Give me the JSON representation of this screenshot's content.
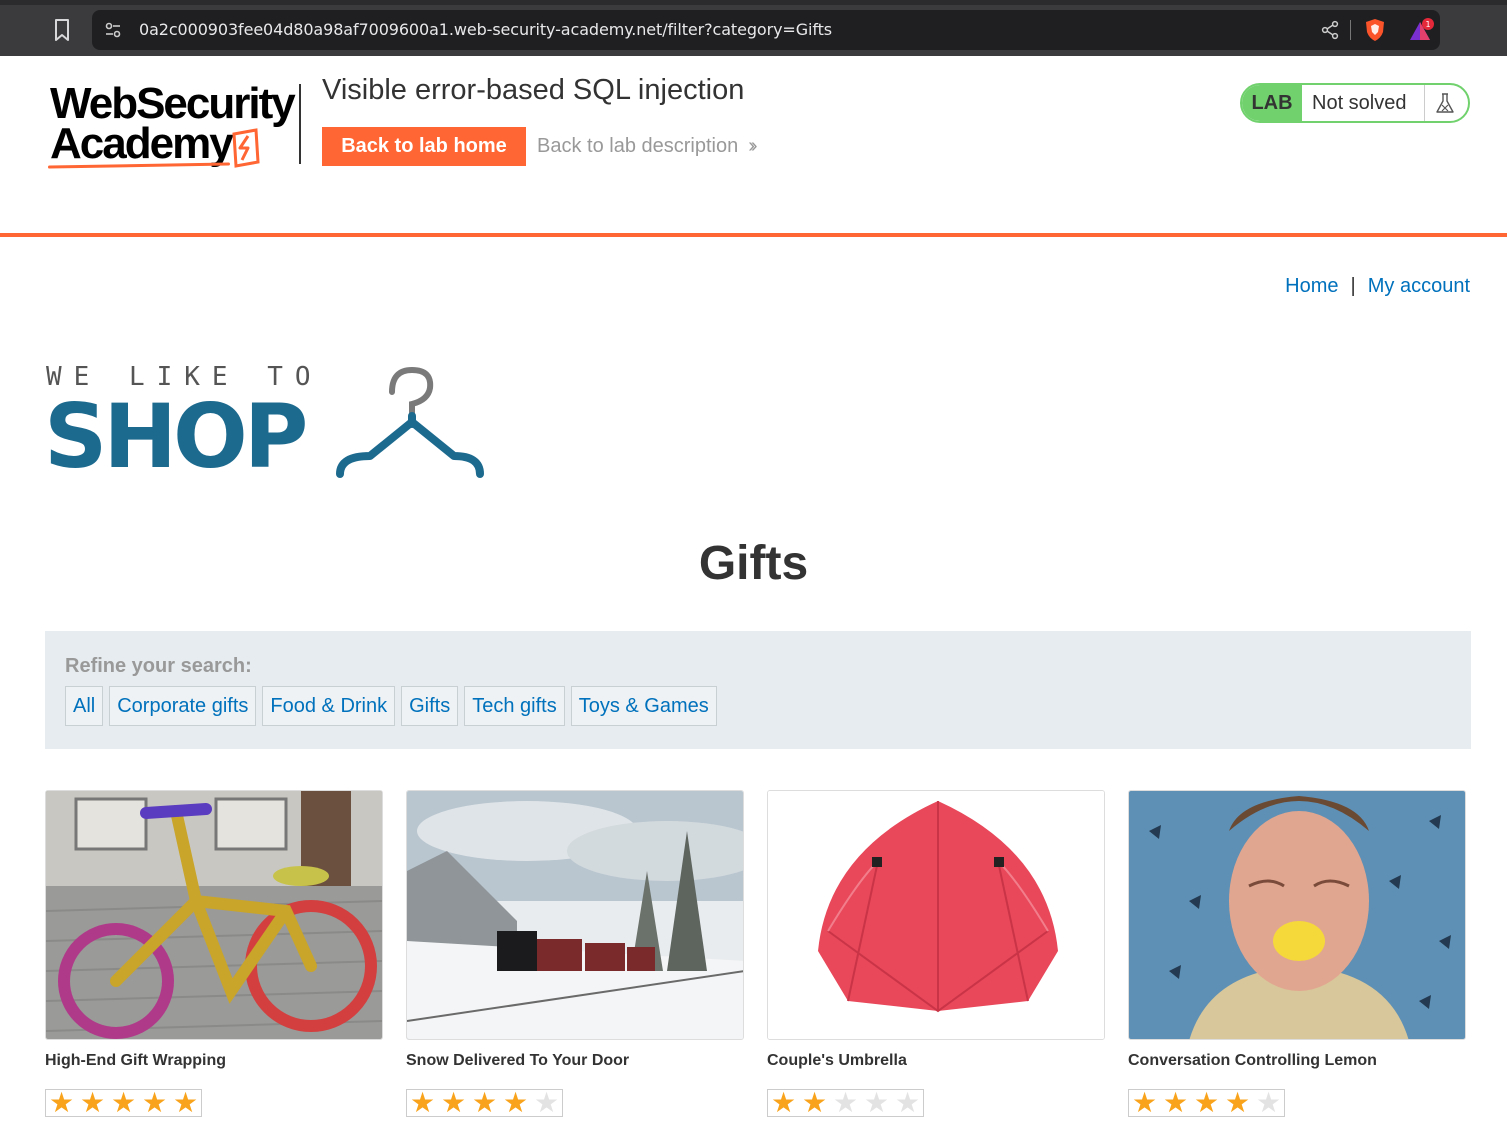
{
  "browser": {
    "url": "0a2c000903fee04d80a98af7009600a1.web-security-academy.net/filter?category=Gifts",
    "rewards_badge": "1"
  },
  "lab_header": {
    "logo_line1": "WebSecurity",
    "logo_line2": "Academy",
    "title": "Visible error-based SQL injection",
    "back_home_label": "Back to lab home",
    "back_description_label": "Back to lab description",
    "status_badge": "LAB",
    "status_text": "Not solved",
    "accent_color": "#ff6633",
    "status_color": "#70d16d"
  },
  "nav": {
    "home": "Home",
    "separator": "|",
    "my_account": "My account"
  },
  "shop_logo": {
    "tagline": "WE LIKE TO",
    "word": "SHOP",
    "color": "#1d6a8f"
  },
  "page": {
    "heading": "Gifts"
  },
  "filters": {
    "title": "Refine your search:",
    "items": [
      "All",
      "Corporate gifts",
      "Food & Drink",
      "Gifts",
      "Tech gifts",
      "Toys & Games"
    ],
    "link_color": "#0071bc"
  },
  "products": [
    {
      "name": "High-End Gift Wrapping",
      "rating": 5,
      "image": "yarn-bombed-bicycle"
    },
    {
      "name": "Snow Delivered To Your Door",
      "rating": 4,
      "image": "steam-train-in-snow"
    },
    {
      "name": "Couple's Umbrella",
      "rating": 2,
      "image": "red-double-umbrella"
    },
    {
      "name": "Conversation Controlling Lemon",
      "rating": 4,
      "image": "man-biting-lemon"
    }
  ]
}
